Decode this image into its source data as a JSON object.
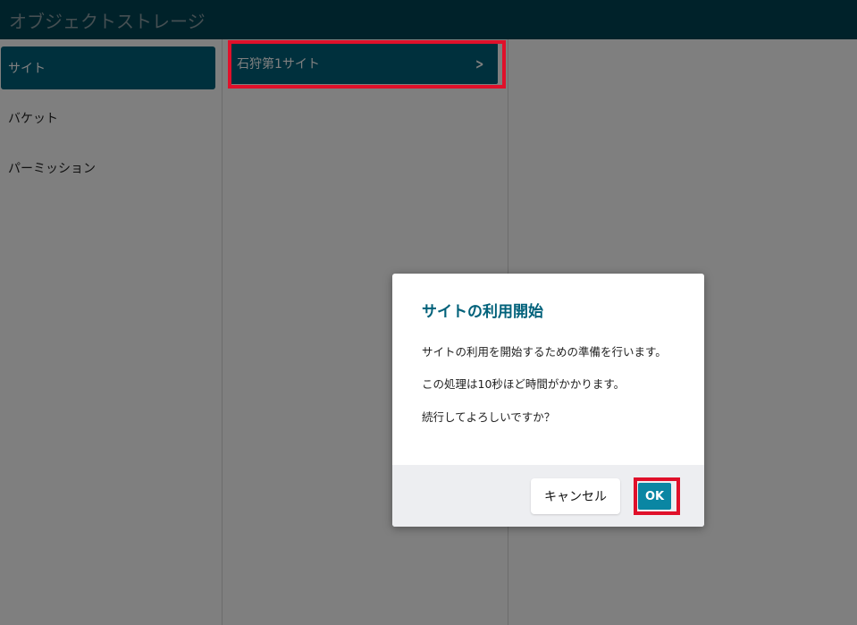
{
  "header": {
    "title": "オブジェクトストレージ"
  },
  "sidebar": {
    "items": [
      {
        "label": "サイト",
        "active": true
      },
      {
        "label": "バケット",
        "active": false
      },
      {
        "label": "パーミッション",
        "active": false
      }
    ]
  },
  "sites": {
    "items": [
      {
        "label": "石狩第1サイト",
        "icon": "chevron-right-icon"
      }
    ]
  },
  "dialog": {
    "title": "サイトの利用開始",
    "lines": [
      "サイトの利用を開始するための準備を行います。",
      "この処理は10秒ほど時間がかかります。",
      "続行してよろしいですか？"
    ],
    "cancel_label": "キャンセル",
    "ok_label": "OK"
  },
  "colors": {
    "header_bg": "#004455",
    "accent": "#00617a",
    "ok_button": "#0a86a3",
    "highlight_border": "#e0102a"
  }
}
